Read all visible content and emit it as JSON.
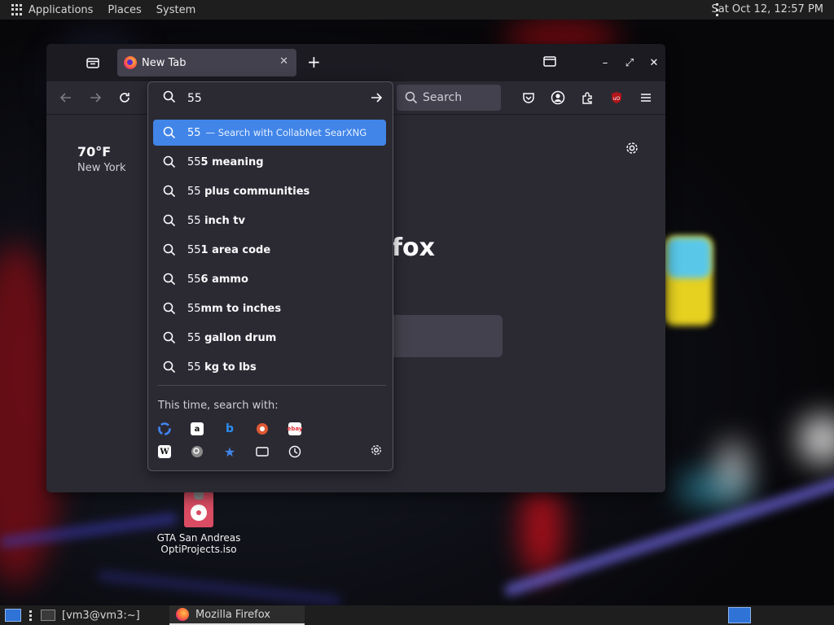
{
  "top_panel": {
    "menus": [
      "Applications",
      "Places",
      "System"
    ],
    "clock": "Sat Oct 12, 12:57 PM"
  },
  "desktop": {
    "icons": [
      {
        "label_line1": "GTA San Andreas",
        "label_line2": "OptiProjects.iso",
        "icon": "disc-image-icon"
      }
    ]
  },
  "browser": {
    "tab_title": "New Tab",
    "url_value": "55",
    "search_placeholder": "Search",
    "weather": {
      "temp": "70°F",
      "city": "New York"
    },
    "logo_fragment": "fox",
    "suggestions": [
      {
        "prefix": "55",
        "rest": "",
        "action": "— Search with CollabNet SearXNG",
        "selected": true
      },
      {
        "prefix": "55",
        "rest": "5 meaning"
      },
      {
        "prefix": "55",
        "rest": " plus communities"
      },
      {
        "prefix": "55",
        "rest": " inch tv"
      },
      {
        "prefix": "55",
        "rest": "1 area code"
      },
      {
        "prefix": "55",
        "rest": "6 ammo"
      },
      {
        "prefix": "55",
        "rest": "mm to inches"
      },
      {
        "prefix": "55",
        "rest": " gallon drum"
      },
      {
        "prefix": "55",
        "rest": " kg to lbs"
      }
    ],
    "this_time_label": "This time, search with:",
    "engines_row1": [
      "google-icon",
      "amazon-icon",
      "bing-icon",
      "duckduckgo-icon",
      "ebay-icon"
    ],
    "engines_row2": [
      "wikipedia-icon",
      "searxng-icon",
      "bookmarks-icon",
      "tabs-icon",
      "history-icon"
    ]
  },
  "taskbar": {
    "items": [
      {
        "label": "[vm3@vm3:~]",
        "icon": "terminal-icon"
      },
      {
        "label": "Mozilla Firefox",
        "icon": "firefox-icon"
      }
    ]
  },
  "colors": {
    "accent": "#4185e8",
    "window_bg": "#2b2a33",
    "titlebar": "#1c1b22"
  }
}
